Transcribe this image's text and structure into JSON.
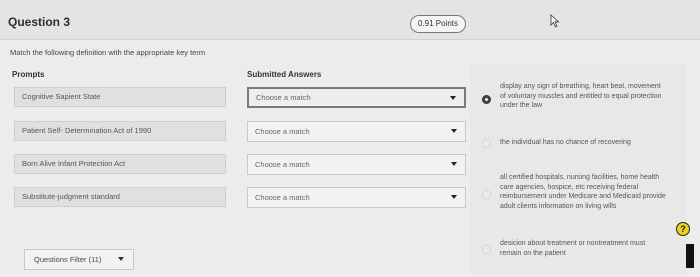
{
  "header": {
    "question_title": "Question 3",
    "points": "0.91 Points"
  },
  "instructions": "Match the following definition with the appropriate key term",
  "columns": {
    "prompts": "Prompts",
    "submitted": "Submitted Answers"
  },
  "prompts": [
    "Cognitive Sapient State",
    "Patient Self- Determination Act of 1990",
    "Born Alive Infant Protection Act",
    "Substitute-judgment standard"
  ],
  "selects": [
    "Choose a match",
    "Choose a match",
    "Choose a match",
    "Choose a match"
  ],
  "answers": [
    {
      "text": "display any sign of breathing, heart beat, movement of voluntary muscles and entitled to equal protection under the law",
      "selected": true
    },
    {
      "text": "the individual has no chance of recovering",
      "selected": false
    },
    {
      "text": "all certified hospitals, nursing facilities, home health care agencies, hospice, etc receiving federal reimbursement under Medicare and Medicaid provide adult clients information on living wills",
      "selected": false
    },
    {
      "text": "desicion about treatment or nontreatment must remain on the patient",
      "selected": false
    }
  ],
  "filter": {
    "label": "Questions Filter (11)"
  },
  "icons": {
    "help": "help-icon",
    "cursor": "cursor-icon",
    "dropdown": "chevron-down-icon"
  },
  "colors": {
    "help_icon": "#f0d020",
    "selected_radio": "#444444"
  }
}
